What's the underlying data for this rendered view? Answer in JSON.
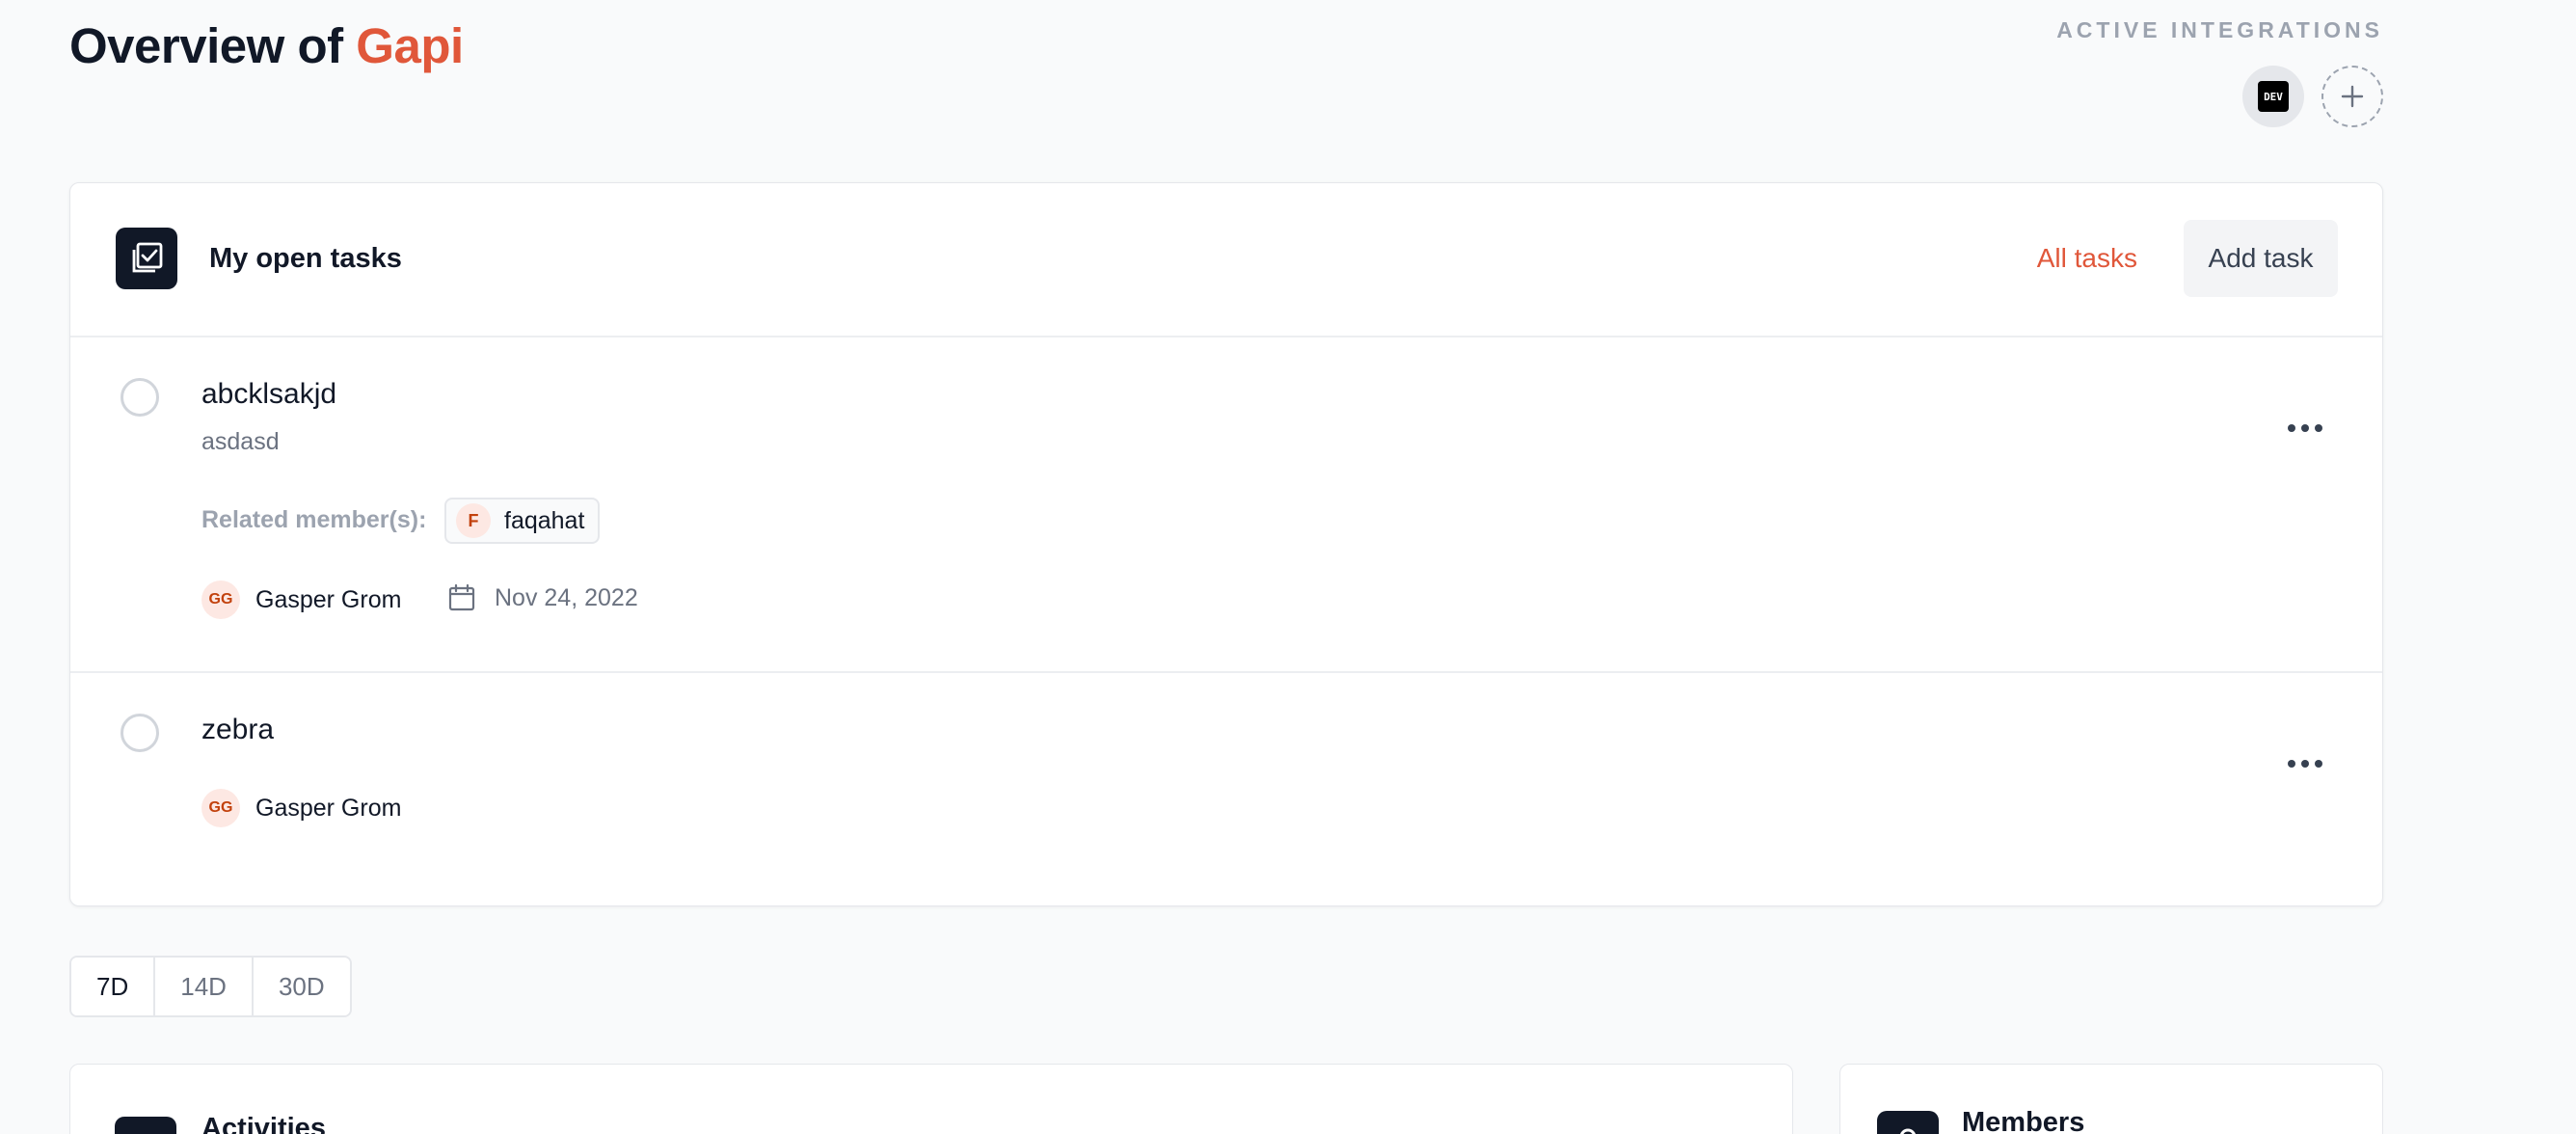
{
  "page": {
    "title_prefix": "Overview of ",
    "title_accent": "Gapi"
  },
  "integrations": {
    "label": "ACTIVE INTEGRATIONS",
    "items": [
      {
        "name": "dev-icon",
        "text": "DEV"
      }
    ],
    "add_icon": "plus-icon"
  },
  "tasks_card": {
    "title": "My open tasks",
    "all_tasks_label": "All tasks",
    "add_task_label": "Add task",
    "tasks": [
      {
        "title": "abcklsakjd",
        "description": "asdasd",
        "related_label": "Related member(s):",
        "related_members": [
          {
            "initial": "F",
            "name": "faqahat"
          }
        ],
        "assignee": {
          "initials": "GG",
          "name": "Gasper Grom"
        },
        "due_date": "Nov 24, 2022"
      },
      {
        "title": "zebra",
        "assignee": {
          "initials": "GG",
          "name": "Gasper Grom"
        }
      }
    ]
  },
  "range_filter": {
    "options": [
      "7D",
      "14D",
      "30D"
    ],
    "selected": "7D"
  },
  "panels": {
    "activities_title": "Activities",
    "members_title": "Members"
  },
  "colors": {
    "accent": "#e0573a",
    "dark": "#111827",
    "muted": "#6b7280"
  }
}
